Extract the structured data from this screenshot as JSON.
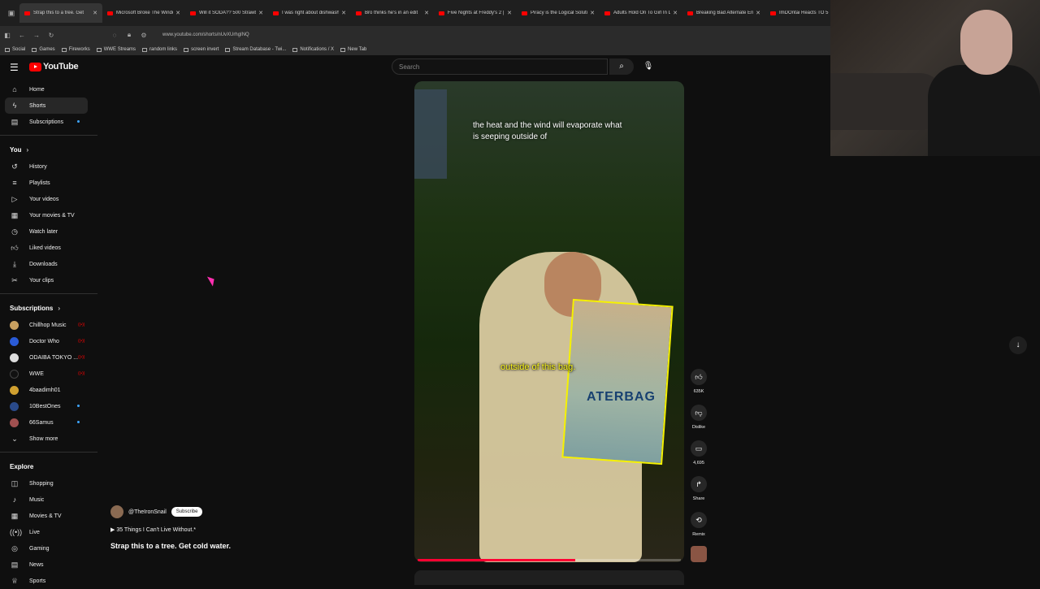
{
  "browser": {
    "tabs": [
      {
        "title": "Strap this to a tree. Get"
      },
      {
        "title": "Microsoft Broke The Windo"
      },
      {
        "title": "Will it SODA?? 500 Strawbe"
      },
      {
        "title": "I was right about dishwashe"
      },
      {
        "title": "Bro thinks he's in an edit"
      },
      {
        "title": "Five Nights at Freddy's 2 | C"
      },
      {
        "title": "Piracy is the Logical Solutio"
      },
      {
        "title": "Adults Hold On To Girl In D"
      },
      {
        "title": "Breaking Bad Alternate Endi"
      },
      {
        "title": "ImDOntai Reacts TO 5"
      }
    ],
    "url": "www.youtube.com/shorts/nUvXUrhgINQ",
    "bookmarks": [
      "Social",
      "Games",
      "Fireworks",
      "WWE Streams",
      "random links",
      "screen invert",
      "Stream Database - Twi...",
      "Notifications / X",
      "New Tab"
    ]
  },
  "header": {
    "logo_text": "YouTube",
    "search_placeholder": "Search"
  },
  "sidebar": {
    "main": [
      {
        "label": "Home",
        "icon": "home-icon"
      },
      {
        "label": "Shorts",
        "icon": "shorts-icon"
      },
      {
        "label": "Subscriptions",
        "icon": "subscriptions-icon"
      }
    ],
    "you_heading": "You",
    "you": [
      {
        "label": "History"
      },
      {
        "label": "Playlists"
      },
      {
        "label": "Your videos"
      },
      {
        "label": "Your movies & TV"
      },
      {
        "label": "Watch later"
      },
      {
        "label": "Liked videos"
      },
      {
        "label": "Downloads"
      },
      {
        "label": "Your clips"
      }
    ],
    "subs_heading": "Subscriptions",
    "subs": [
      {
        "label": "Chillhop Music",
        "color": "#c8a060"
      },
      {
        "label": "Doctor Who",
        "color": "#2a5bd7"
      },
      {
        "label": "ODAIBA TOKYO ...",
        "color": "#dddddd"
      },
      {
        "label": "WWE",
        "color": "#111111"
      },
      {
        "label": "4baadimh01",
        "color": "#d0a030"
      },
      {
        "label": "10BestOnes",
        "color": "#2a4a8a"
      },
      {
        "label": "66Samus",
        "color": "#a05050"
      }
    ],
    "show_more": "Show more",
    "explore_heading": "Explore",
    "explore": [
      {
        "label": "Shopping"
      },
      {
        "label": "Music"
      },
      {
        "label": "Movies & TV"
      },
      {
        "label": "Live"
      },
      {
        "label": "Gaming"
      },
      {
        "label": "News"
      },
      {
        "label": "Sports"
      }
    ]
  },
  "video": {
    "caption_top": "the heat and the wind will evaporate what is seeping outside of",
    "caption_mid": "outside of this bag.",
    "bag_text": "ATERBAG",
    "progress": 0.6
  },
  "channel": {
    "handle": "@TheIronSnail",
    "subscribe": "Subscribe",
    "playlist": "35 Things I Can't Live Without.*",
    "title": "Strap this to a tree. Get cold water."
  },
  "actions": {
    "likes": "635K",
    "dislike": "Dislike",
    "comments": "4,695",
    "share": "Share",
    "remix": "Remix"
  }
}
